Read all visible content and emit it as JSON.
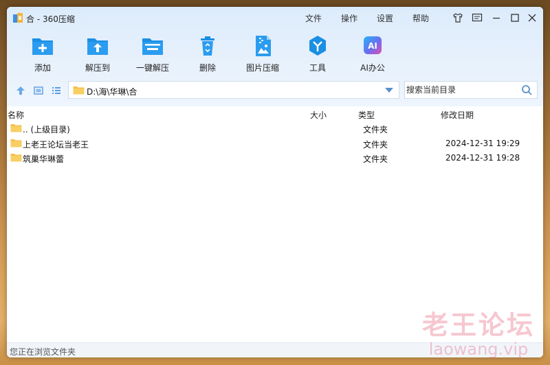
{
  "window": {
    "title": "合 - 360压缩"
  },
  "menu": {
    "file": "文件",
    "operate": "操作",
    "settings": "设置",
    "help": "帮助"
  },
  "title_icons": [
    "shirt-icon",
    "feedback-icon",
    "minimize-icon",
    "maximize-icon",
    "close-icon"
  ],
  "toolbar": [
    {
      "label": "添加",
      "icon": "add-folder-icon"
    },
    {
      "label": "解压到",
      "icon": "extract-to-icon"
    },
    {
      "label": "一键解压",
      "icon": "one-click-extract-icon"
    },
    {
      "label": "删除",
      "icon": "recycle-bin-icon"
    },
    {
      "label": "图片压缩",
      "icon": "image-compress-icon"
    },
    {
      "label": "工具",
      "icon": "tools-icon"
    },
    {
      "label": "AI办公",
      "icon": "ai-office-icon"
    }
  ],
  "nav": {
    "path": "D:\\海\\华琳\\合",
    "search_placeholder": "搜索当前目录"
  },
  "columns": {
    "name": "名称",
    "size": "大小",
    "type": "类型",
    "modified": "修改日期"
  },
  "files": [
    {
      "name": ".. (上级目录)",
      "type": "文件夹",
      "date": ""
    },
    {
      "name": "上老王论坛当老王",
      "type": "文件夹",
      "date": "2024-12-31 19:29"
    },
    {
      "name": "筑巢华琳蕾",
      "type": "文件夹",
      "date": "2024-12-31 19:28"
    }
  ],
  "status": "您正在浏览文件夹",
  "watermark": {
    "line1": "老王论坛",
    "line2": "laowang.vip"
  },
  "colors": {
    "accent": "#1a8fe3",
    "folder": "#f4c04e",
    "title_band": "#dcebfb"
  }
}
